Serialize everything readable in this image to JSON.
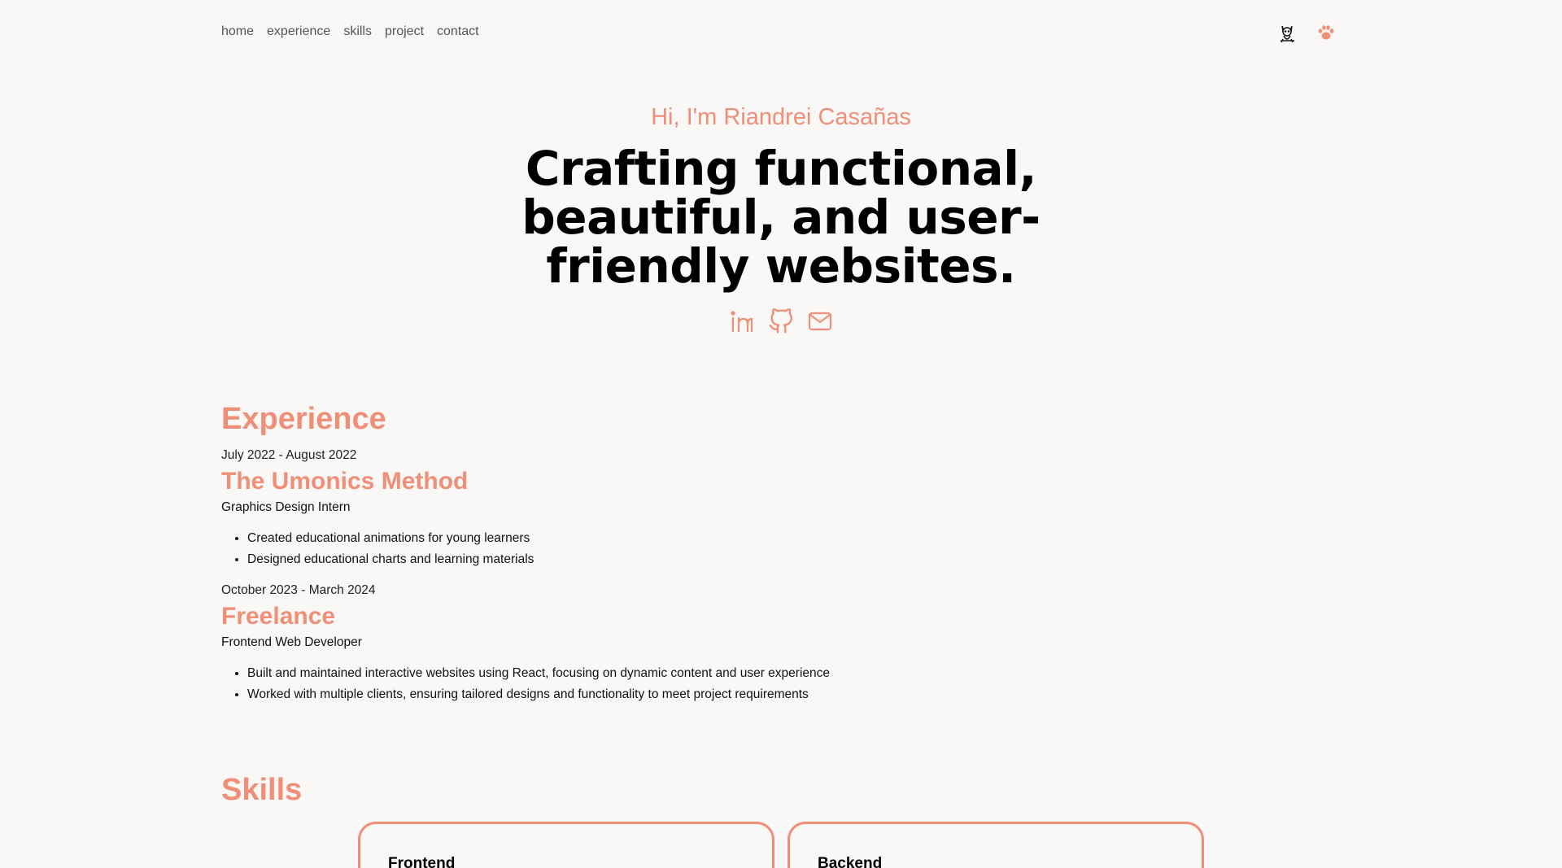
{
  "nav": {
    "items": [
      "home",
      "experience",
      "skills",
      "project",
      "contact"
    ]
  },
  "top_icons": [
    "cat-icon",
    "paw-icon"
  ],
  "hero": {
    "greeting": "Hi, I'm Riandrei Casañas",
    "headline": "Crafting functional, beautiful, and user-friendly websites."
  },
  "socials": [
    "linkedin-icon",
    "github-icon",
    "mail-icon"
  ],
  "experience": {
    "title": "Experience",
    "jobs": [
      {
        "date": "July 2022 - August 2022",
        "company": "The Umonics Method",
        "role": "Graphics Design Intern",
        "bullets": [
          "Created educational animations for young learners",
          "Designed educational charts and learning materials"
        ]
      },
      {
        "date": "October 2023 - March 2024",
        "company": "Freelance",
        "role": "Frontend Web Developer",
        "bullets": [
          "Built and maintained interactive websites using React, focusing on dynamic content and user experience",
          "Worked with multiple clients, ensuring tailored designs and functionality to meet project requirements"
        ]
      }
    ]
  },
  "skills": {
    "title": "Skills",
    "cards": [
      "Frontend",
      "Backend"
    ]
  },
  "colors": {
    "accent": "#f08f78",
    "background": "#faf8f6"
  }
}
